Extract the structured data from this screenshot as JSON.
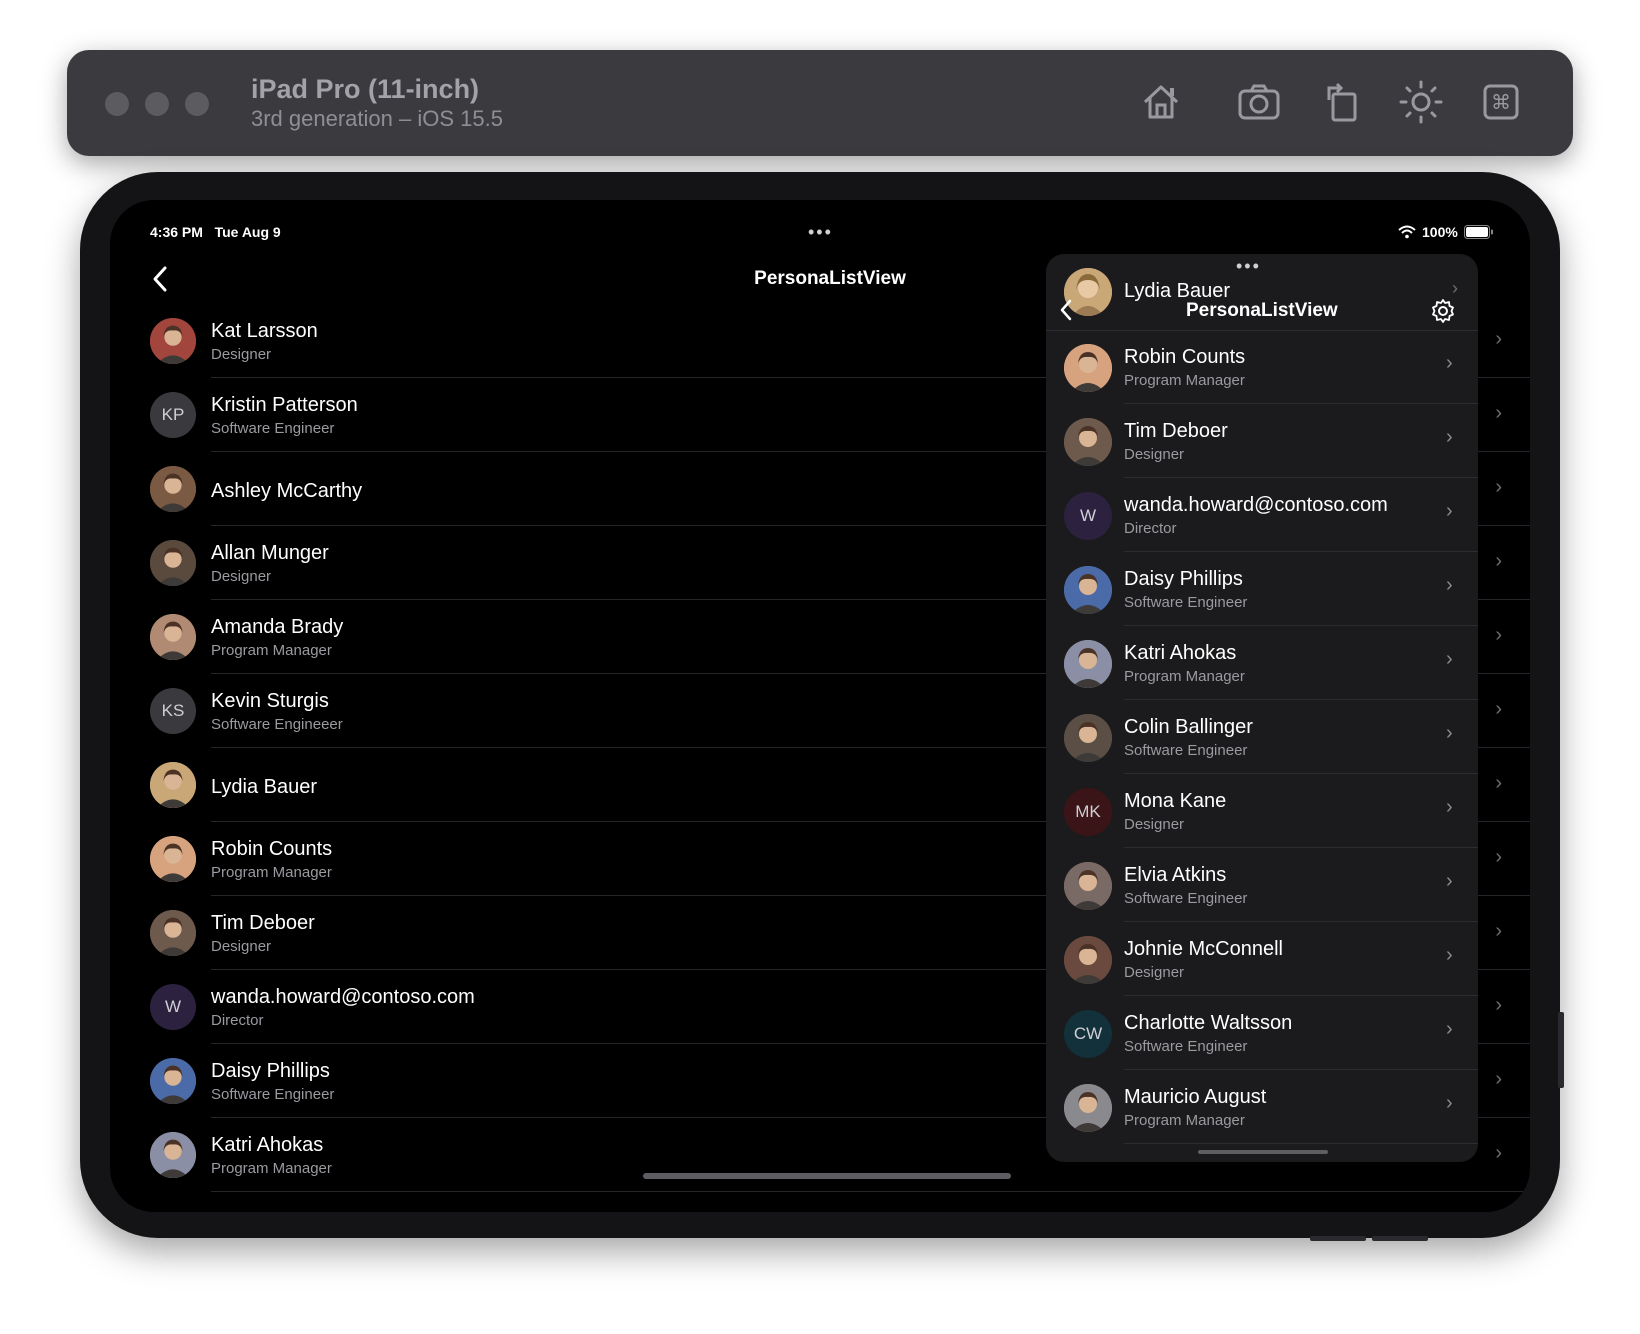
{
  "simulator": {
    "device_name": "iPad Pro (11-inch)",
    "device_detail": "3rd generation – iOS 15.5",
    "toolbar_icons": [
      "home-icon",
      "screenshot-icon",
      "rotate-icon",
      "appearance-icon",
      "command-icon"
    ]
  },
  "status_bar": {
    "time": "4:36 PM",
    "date": "Tue Aug 9",
    "battery": "100%"
  },
  "nav": {
    "title": "PersonaListView"
  },
  "list": [
    {
      "name": "Kat Larsson",
      "role": "Designer",
      "avatar": "photo",
      "color": "#a2453c"
    },
    {
      "name": "Kristin Patterson",
      "role": "Software Engineer",
      "avatar": "KP",
      "color": "#3a3a3e"
    },
    {
      "name": "Ashley McCarthy",
      "role": "",
      "avatar": "photo",
      "color": "#7a5a42"
    },
    {
      "name": "Allan Munger",
      "role": "Designer",
      "avatar": "photo",
      "color": "#5a4a3e"
    },
    {
      "name": "Amanda Brady",
      "role": "Program Manager",
      "avatar": "photo",
      "color": "#b08a72"
    },
    {
      "name": "Kevin Sturgis",
      "role": "Software Engineeer",
      "avatar": "KS",
      "color": "#3a3a3e"
    },
    {
      "name": "Lydia Bauer",
      "role": "",
      "avatar": "photo",
      "color": "#c9a777"
    },
    {
      "name": "Robin Counts",
      "role": "Program Manager",
      "avatar": "photo",
      "color": "#d7a27e"
    },
    {
      "name": "Tim Deboer",
      "role": "Designer",
      "avatar": "photo",
      "color": "#6d5a4c"
    },
    {
      "name": "wanda.howard@contoso.com",
      "role": "Director",
      "avatar": "W",
      "color": "#2c2240"
    },
    {
      "name": "Daisy Phillips",
      "role": "Software Engineer",
      "avatar": "photo",
      "color": "#4b6aa8"
    },
    {
      "name": "Katri Ahokas",
      "role": "Program Manager",
      "avatar": "photo",
      "color": "#8b8fa6"
    }
  ],
  "panel": {
    "header_name": "Lydia Bauer",
    "header_title": "PersonaListView",
    "items": [
      {
        "name": "Robin Counts",
        "role": "Program Manager",
        "avatar": "photo",
        "color": "#d7a27e"
      },
      {
        "name": "Tim Deboer",
        "role": "Designer",
        "avatar": "photo",
        "color": "#6d5a4c"
      },
      {
        "name": "wanda.howard@contoso.com",
        "role": "Director",
        "avatar": "W",
        "color": "#2c2240"
      },
      {
        "name": "Daisy Phillips",
        "role": "Software Engineer",
        "avatar": "photo",
        "color": "#4b6aa8"
      },
      {
        "name": "Katri Ahokas",
        "role": "Program Manager",
        "avatar": "photo",
        "color": "#8b8fa6"
      },
      {
        "name": "Colin Ballinger",
        "role": "Software Engineer",
        "avatar": "photo",
        "color": "#5a4e45"
      },
      {
        "name": "Mona Kane",
        "role": "Designer",
        "avatar": "MK",
        "color": "#3b1418"
      },
      {
        "name": "Elvia Atkins",
        "role": "Software Engineer",
        "avatar": "photo",
        "color": "#7a6a66"
      },
      {
        "name": "Johnie McConnell",
        "role": "Designer",
        "avatar": "photo",
        "color": "#6a4a3e"
      },
      {
        "name": "Charlotte Waltsson",
        "role": "Software Engineer",
        "avatar": "CW",
        "color": "#12313a"
      },
      {
        "name": "Mauricio August",
        "role": "Program Manager",
        "avatar": "photo",
        "color": "#8a8a8e"
      }
    ]
  }
}
